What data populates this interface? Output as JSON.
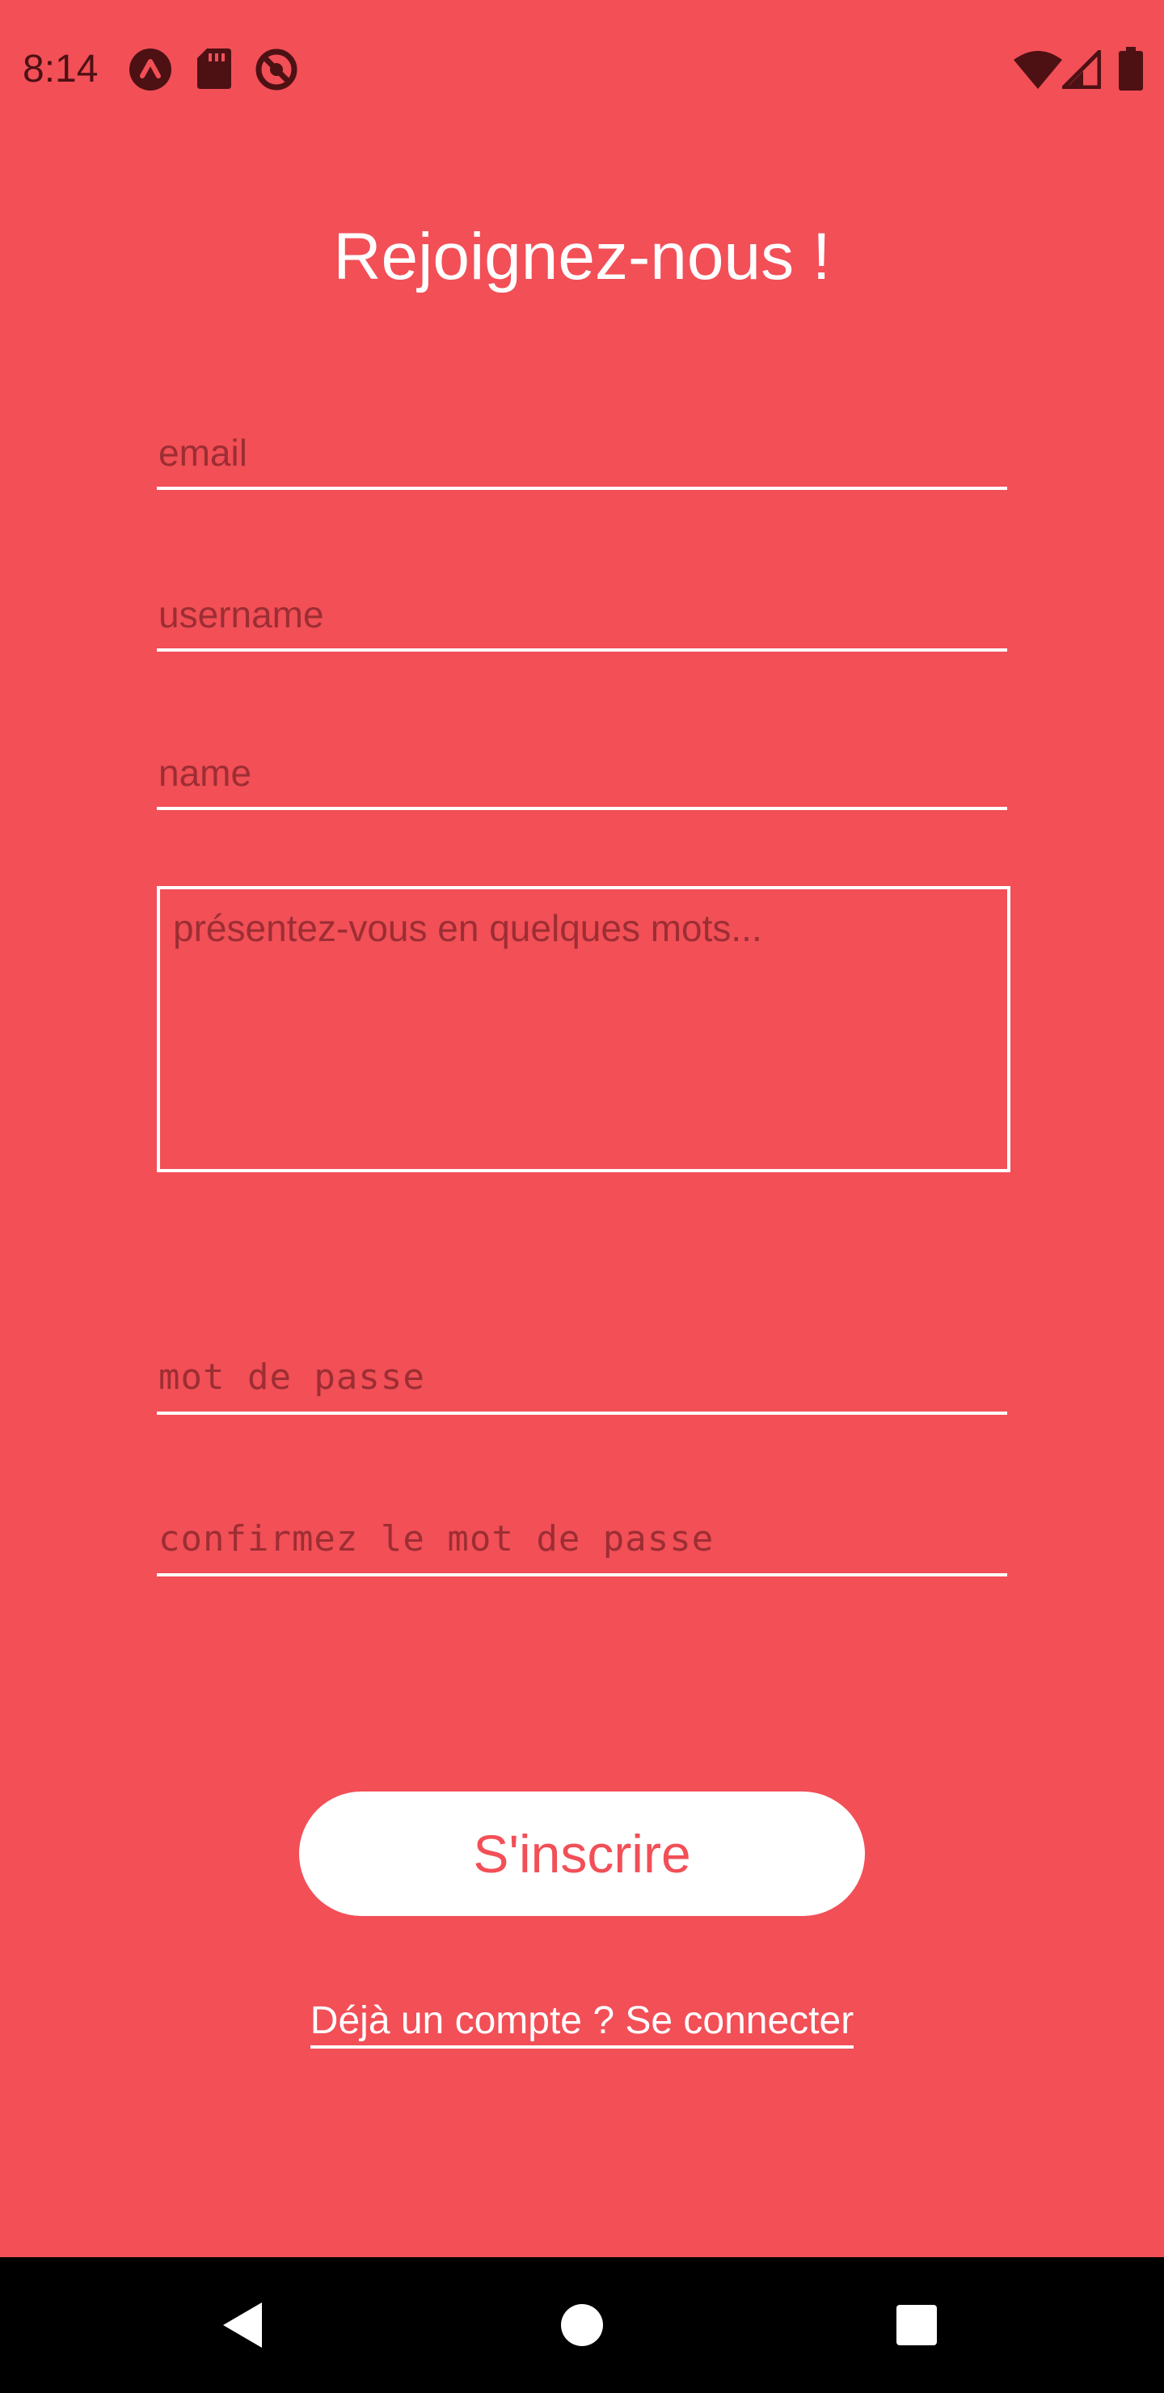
{
  "status_bar": {
    "time": "8:14",
    "left_icons": [
      "app-notification-icon",
      "sd-card-icon",
      "do-not-disturb-icon"
    ],
    "right_icons": [
      "wifi-icon",
      "signal-icon",
      "battery-icon"
    ]
  },
  "page": {
    "title": "Rejoignez-nous !",
    "background_color": "#f24f57"
  },
  "form": {
    "email": {
      "value": "",
      "placeholder": "email"
    },
    "username": {
      "value": "",
      "placeholder": "username"
    },
    "name": {
      "value": "",
      "placeholder": "name"
    },
    "bio": {
      "value": "",
      "placeholder": "présentez-vous en quelques mots..."
    },
    "password": {
      "value": "",
      "placeholder": "mot de passe"
    },
    "confirm_password": {
      "value": "",
      "placeholder": "confirmez le mot de passe"
    }
  },
  "actions": {
    "submit_label": "S'inscrire",
    "login_link_label": "Déjà un compte ? Se connecter"
  },
  "nav_bar": {
    "icons": [
      "back-icon",
      "home-icon",
      "recents-icon"
    ]
  }
}
